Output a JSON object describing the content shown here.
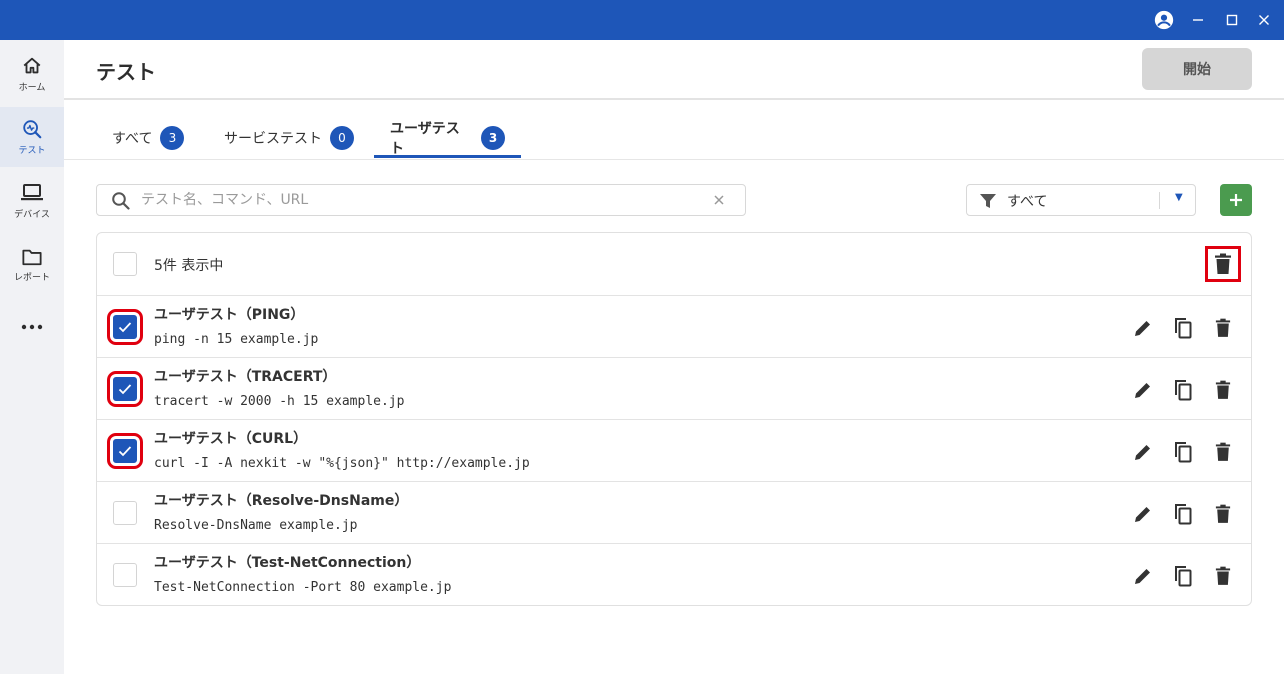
{
  "header": {
    "title": "テスト",
    "start_label": "開始"
  },
  "sidebar": {
    "items": [
      {
        "label": "ホーム",
        "icon": "home-icon"
      },
      {
        "label": "テスト",
        "icon": "test-icon",
        "active": true
      },
      {
        "label": "デバイス",
        "icon": "laptop-icon"
      },
      {
        "label": "レポート",
        "icon": "folder-icon"
      }
    ],
    "more_icon": "more-icon"
  },
  "tabs": [
    {
      "label": "すべて",
      "count": "3"
    },
    {
      "label": "サービステスト",
      "count": "0"
    },
    {
      "label": "ユーザテスト",
      "count": "3",
      "active": true
    }
  ],
  "search": {
    "placeholder": "テスト名、コマンド、URL",
    "value": ""
  },
  "filter": {
    "value": "すべて"
  },
  "list": {
    "count_text": "5件 表示中",
    "rows": [
      {
        "title": "ユーザテスト（PING）",
        "command": "ping -n 15 example.jp",
        "checked": true
      },
      {
        "title": "ユーザテスト（TRACERT）",
        "command": "tracert -w 2000 -h 15 example.jp",
        "checked": true
      },
      {
        "title": "ユーザテスト（CURL）",
        "command": "curl -I -A nexkit -w \"%{json}\" http://example.jp",
        "checked": true
      },
      {
        "title": "ユーザテスト（Resolve-DnsName）",
        "command": "Resolve-DnsName example.jp",
        "checked": false
      },
      {
        "title": "ユーザテスト（Test-NetConnection）",
        "command": "Test-NetConnection -Port 80 example.jp",
        "checked": false
      }
    ]
  },
  "colors": {
    "accent": "#1e56b8",
    "add_button": "#4b9b4f",
    "highlight": "#e0000f"
  }
}
